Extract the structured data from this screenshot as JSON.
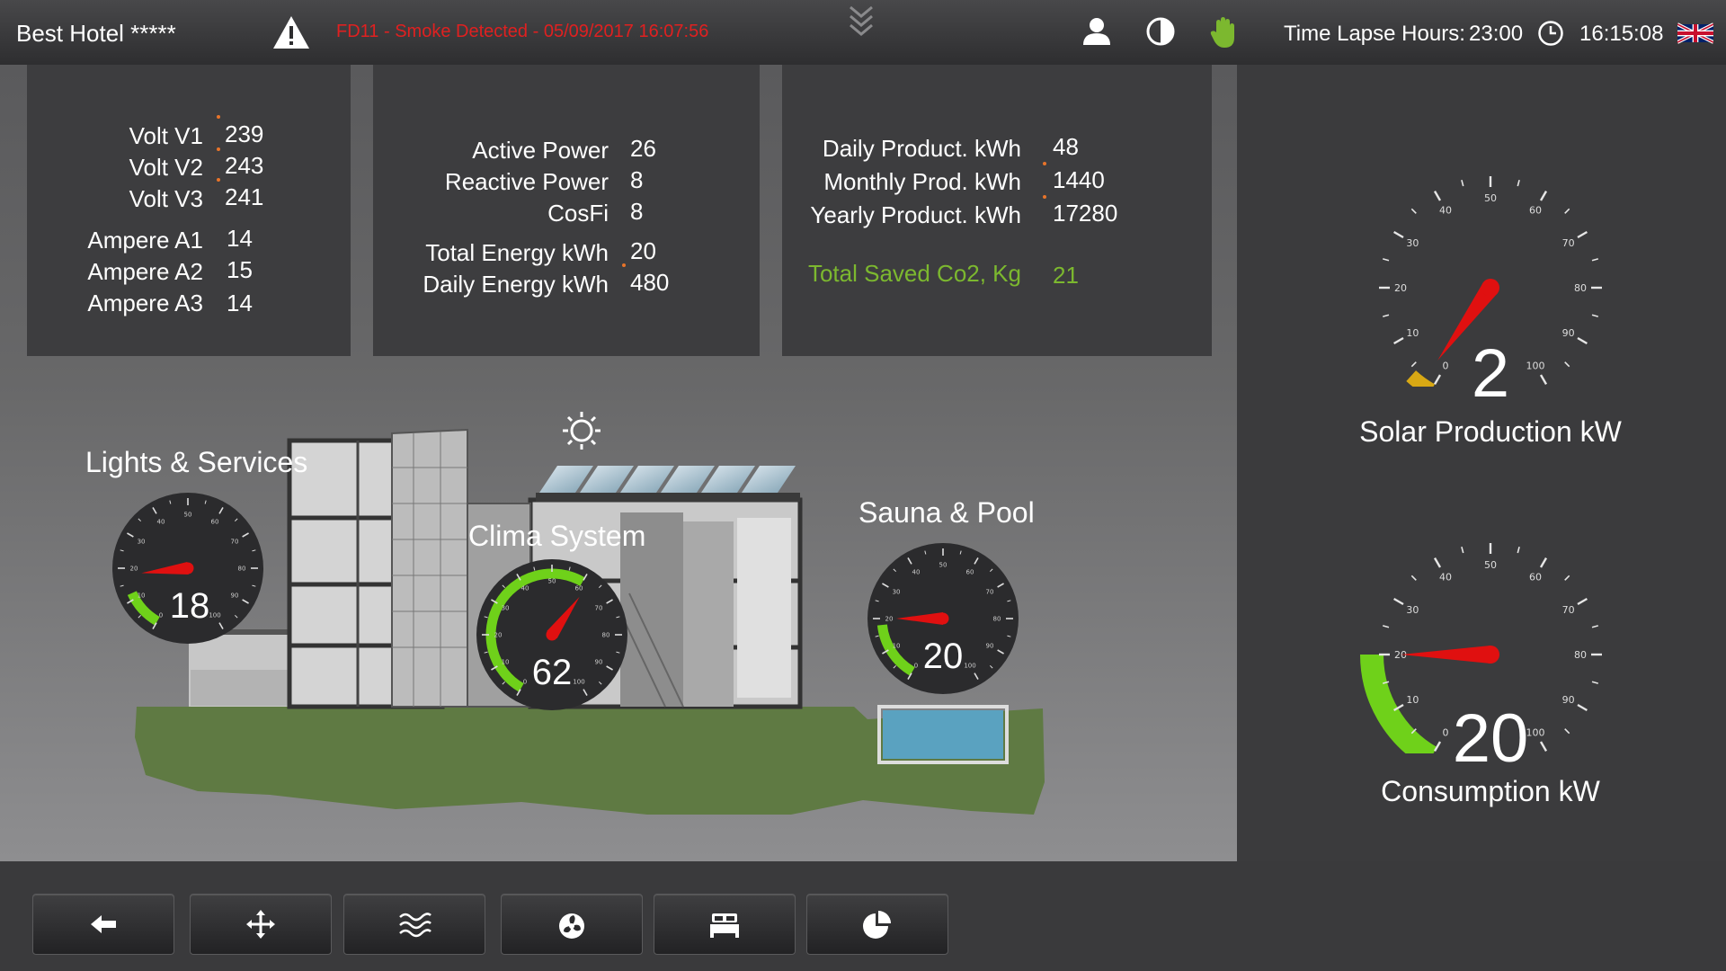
{
  "header": {
    "hotel_name": "Best Hotel *****",
    "alarm_text": "FD11 - Smoke Detected - 05/09/2017 16:07:56",
    "time_lapse_label": "Time Lapse Hours:",
    "time_lapse_value": "23:00",
    "clock": "16:15:08",
    "icons": [
      "warning-icon",
      "chevron-down-icon",
      "user-icon",
      "contrast-icon",
      "hand-icon",
      "clock-icon",
      "uk-flag-icon"
    ]
  },
  "panel_voltage": {
    "rows": [
      {
        "label": "Volt V1",
        "value": "239"
      },
      {
        "label": "Volt V2",
        "value": "243"
      },
      {
        "label": "Volt V3",
        "value": "241"
      },
      {
        "label": "Ampere A1",
        "value": "14"
      },
      {
        "label": "Ampere A2",
        "value": "15"
      },
      {
        "label": "Ampere A3",
        "value": "14"
      }
    ]
  },
  "panel_power": {
    "rows": [
      {
        "label": "Active Power",
        "value": "26"
      },
      {
        "label": "Reactive Power",
        "value": "8"
      },
      {
        "label": "CosFi",
        "value": "8"
      },
      {
        "label": "Total Energy kWh",
        "value": "20"
      },
      {
        "label": "Daily Energy kWh",
        "value": "480"
      }
    ]
  },
  "panel_production": {
    "rows": [
      {
        "label": "Daily Product. kWh",
        "value": "48"
      },
      {
        "label": "Monthly Prod. kWh",
        "value": "1440"
      },
      {
        "label": "Yearly Product. kWh",
        "value": "17280"
      }
    ],
    "co2_label": "Total Saved Co2, Kg",
    "co2_value": "21",
    "co2_color": "#7cb82f"
  },
  "zones": {
    "lights": {
      "title": "Lights & Services",
      "value": "18"
    },
    "clima": {
      "title": "Clima System",
      "value": "62"
    },
    "sauna": {
      "title": "Sauna & Pool",
      "value": "20"
    }
  },
  "solar": {
    "value": "2",
    "label": "Solar Production kW"
  },
  "consumption": {
    "value": "20",
    "label": "Consumption kW"
  },
  "gauge_scale": [
    "0",
    "10",
    "20",
    "30",
    "40",
    "50",
    "60",
    "70",
    "80",
    "90",
    "100"
  ],
  "nav": [
    "back-arrow-icon",
    "move-icon",
    "waves-icon",
    "fan-icon",
    "bed-icon",
    "pie-chart-icon"
  ],
  "colors": {
    "alarm": "#e02020",
    "needle": "#e01010",
    "accent": "#e8742a",
    "green": "#7cb82f"
  }
}
